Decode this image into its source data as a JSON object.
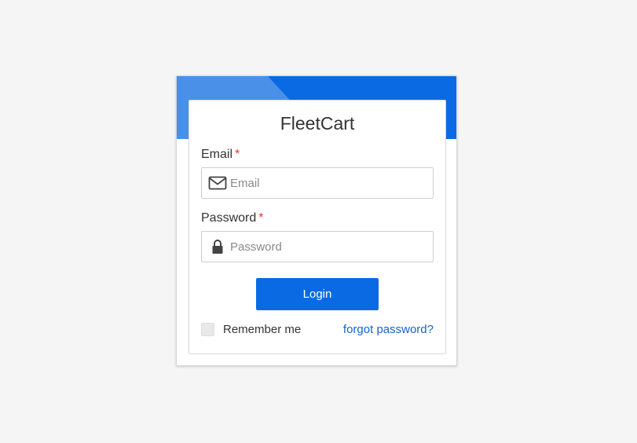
{
  "app": {
    "title": "FleetCart"
  },
  "form": {
    "email": {
      "label": "Email",
      "required_mark": "*",
      "placeholder": "Email",
      "value": "",
      "icon": "envelope-icon"
    },
    "password": {
      "label": "Password",
      "required_mark": "*",
      "placeholder": "Password",
      "value": "",
      "icon": "lock-icon"
    },
    "login_label": "Login",
    "remember_label": "Remember me",
    "remember_checked": false,
    "forgot_label": "forgot password?"
  },
  "colors": {
    "page_background": "#f5f5f5",
    "header_blue": "#0a6ae4",
    "header_light_blue": "#4a90e8",
    "button_blue": "#0a6ae4",
    "link_blue": "#1a62c9",
    "required_red": "#e53935"
  }
}
